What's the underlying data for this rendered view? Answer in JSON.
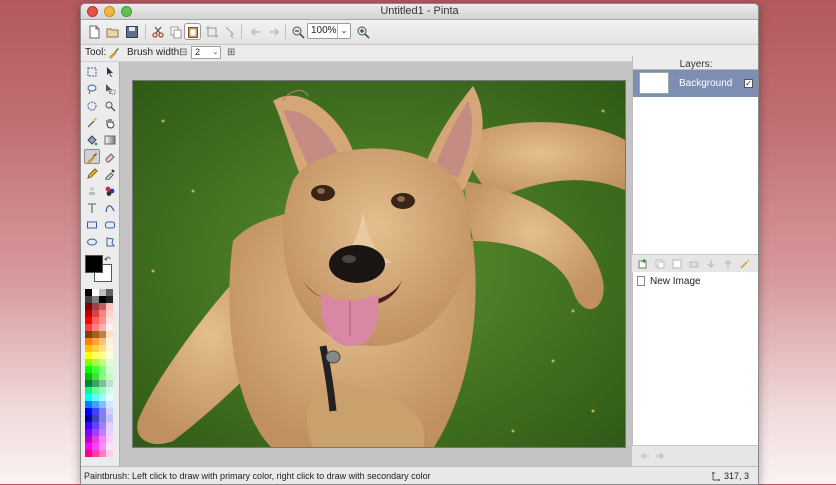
{
  "window": {
    "title": "Untitled1 - Pinta"
  },
  "toolbar": {
    "buttons": [
      "new-icon",
      "open-icon",
      "save-icon",
      "cut-icon",
      "copy-icon",
      "paste-icon",
      "crop-icon",
      "deselect-icon",
      "undo-icon",
      "redo-icon",
      "zoom-out-icon",
      "zoom-in-icon"
    ],
    "zoom_value": "100%"
  },
  "tool_options": {
    "tool_label": "Tool:",
    "brush_width_label": "Brush width:",
    "brush_width_value": "2",
    "minus": "⊟",
    "plus": "⊞",
    "dropdown_arrow": "⌄"
  },
  "palette": {
    "primary_color": "#000000",
    "secondary_color": "#ffffff",
    "columns": [
      [
        "#000000",
        "#404040",
        "#800000",
        "#c00000",
        "#ff0000",
        "#ff4040",
        "#804000",
        "#ff8000",
        "#ffc000",
        "#ffff00",
        "#80ff00",
        "#00ff00",
        "#00c000",
        "#008040",
        "#00ff80",
        "#00ffff",
        "#0080ff",
        "#0000ff",
        "#0000a0",
        "#4000ff",
        "#8000ff",
        "#c000c0",
        "#ff00ff",
        "#ff0080"
      ],
      [
        "#ffffff",
        "#808080",
        "#a04040",
        "#e04040",
        "#ff6060",
        "#ff8080",
        "#a06020",
        "#ffa040",
        "#ffd040",
        "#ffff60",
        "#a0ff40",
        "#40ff40",
        "#40e040",
        "#40a060",
        "#60ffa0",
        "#60ffff",
        "#40a0ff",
        "#4040ff",
        "#4040c0",
        "#6040ff",
        "#a040ff",
        "#e040e0",
        "#ff40ff",
        "#ff40a0"
      ],
      [
        "#c0c0c0",
        "#000000",
        "#c06060",
        "#ff8080",
        "#ff9090",
        "#ffb0b0",
        "#c08040",
        "#ffc080",
        "#ffe080",
        "#ffff90",
        "#c0ff80",
        "#80ff80",
        "#80ff80",
        "#80c090",
        "#90ffc0",
        "#a0ffff",
        "#80c0ff",
        "#8080ff",
        "#8080e0",
        "#a080ff",
        "#c080ff",
        "#ff80ff",
        "#ff90ff",
        "#ff80c0"
      ],
      [
        "#606060",
        "#202020",
        "#ffc0c0",
        "#ffd0d0",
        "#ffe0e0",
        "#fff0f0",
        "#ffe0c0",
        "#fff0e0",
        "#fff8d0",
        "#ffffe0",
        "#e0ffd0",
        "#d0ffd0",
        "#c0ffc0",
        "#c0e0d0",
        "#d0ffe8",
        "#e0ffff",
        "#d0e8ff",
        "#d0d0ff",
        "#c0c0ff",
        "#e0d0ff",
        "#f0d0ff",
        "#ffd0ff",
        "#ffe0ff",
        "#ffd0e8"
      ]
    ]
  },
  "layers": {
    "title": "Layers:",
    "items": [
      {
        "name": "Background",
        "visible_mark": "✓"
      }
    ]
  },
  "history": {
    "items": [
      {
        "label": "New Image"
      }
    ]
  },
  "status": {
    "text": "Paintbrush: Left click to draw with primary color, right click to draw with secondary color",
    "cursor_position": "317, 3"
  }
}
